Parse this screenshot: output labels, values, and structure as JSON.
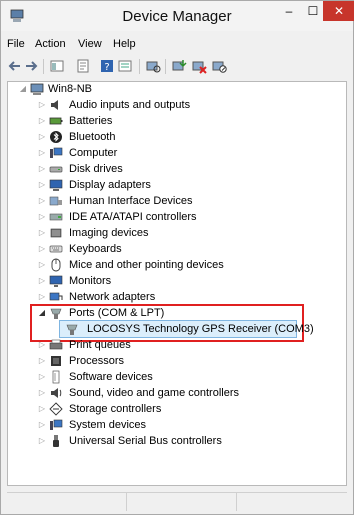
{
  "window": {
    "title": "Device Manager",
    "minimize": "–",
    "maximize": "☐",
    "close": "✕"
  },
  "menu": [
    "File",
    "Action",
    "View",
    "Help"
  ],
  "toolbar_icons": [
    "back-icon",
    "forward-icon",
    "show-hide-tree-icon",
    "properties-icon",
    "help-icon",
    "view-icon",
    "scan-hardware-icon",
    "update-driver-icon",
    "uninstall-icon",
    "disable-icon"
  ],
  "tree": {
    "root": "Win8-NB",
    "items": [
      {
        "label": "Audio inputs and outputs",
        "icon": "speaker-icon"
      },
      {
        "label": "Batteries",
        "icon": "battery-icon"
      },
      {
        "label": "Bluetooth",
        "icon": "bluetooth-icon"
      },
      {
        "label": "Computer",
        "icon": "computer-icon"
      },
      {
        "label": "Disk drives",
        "icon": "disk-drive-icon"
      },
      {
        "label": "Display adapters",
        "icon": "display-adapter-icon"
      },
      {
        "label": "Human Interface Devices",
        "icon": "hid-icon"
      },
      {
        "label": "IDE ATA/ATAPI controllers",
        "icon": "ide-controller-icon"
      },
      {
        "label": "Imaging devices",
        "icon": "camera-icon"
      },
      {
        "label": "Keyboards",
        "icon": "keyboard-icon"
      },
      {
        "label": "Mice and other pointing devices",
        "icon": "mouse-icon"
      },
      {
        "label": "Monitors",
        "icon": "monitor-icon"
      },
      {
        "label": "Network adapters",
        "icon": "network-adapter-icon"
      },
      {
        "label": "Ports (COM & LPT)",
        "icon": "port-icon",
        "expanded": true
      },
      {
        "label": "LOCOSYS Technology GPS Receiver (COM3)",
        "icon": "port-icon",
        "child": true,
        "selected": true
      },
      {
        "label": "Print queues",
        "icon": "printer-icon"
      },
      {
        "label": "Processors",
        "icon": "processor-icon"
      },
      {
        "label": "Software devices",
        "icon": "software-device-icon"
      },
      {
        "label": "Sound, video and game controllers",
        "icon": "sound-icon"
      },
      {
        "label": "Storage controllers",
        "icon": "storage-controller-icon"
      },
      {
        "label": "System devices",
        "icon": "system-device-icon"
      },
      {
        "label": "Universal Serial Bus controllers",
        "icon": "usb-icon"
      }
    ]
  },
  "colors": {
    "highlight_border": "#e02020",
    "selection_bg": "#dbeefb",
    "close_button": "#c7352b"
  }
}
